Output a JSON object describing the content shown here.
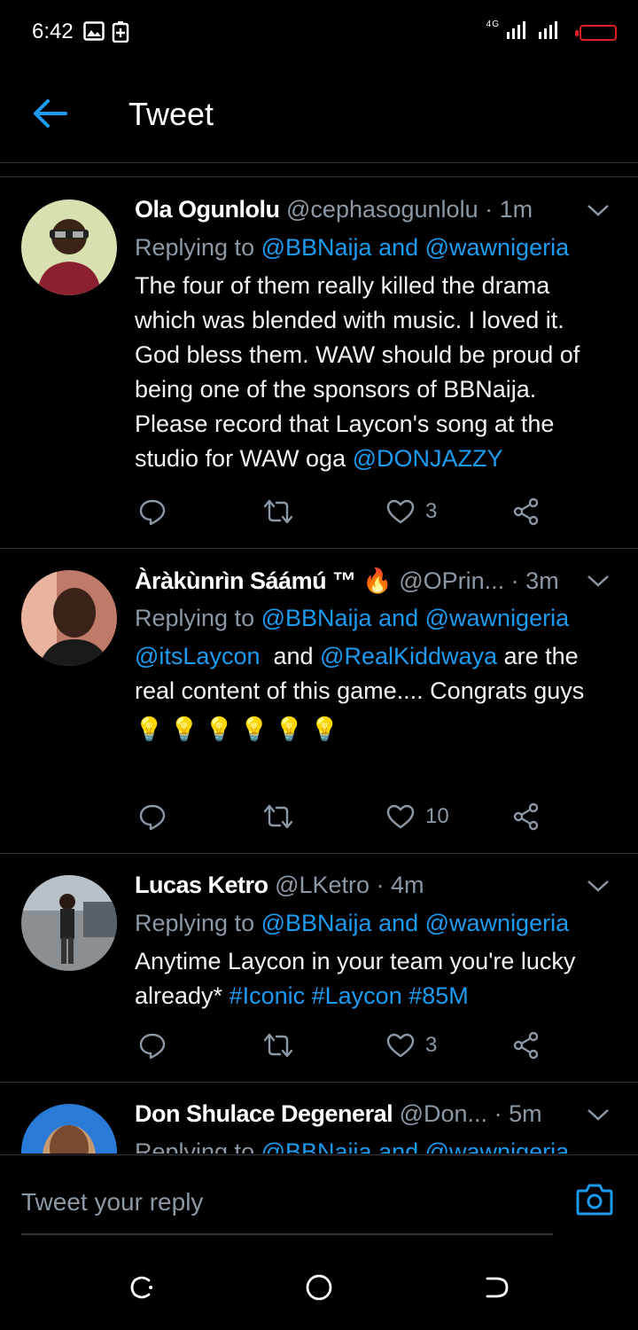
{
  "status_bar": {
    "time": "6:42",
    "signal_label": "4G"
  },
  "header": {
    "title": "Tweet"
  },
  "tweets": [
    {
      "name": "Ola Ogunlolu",
      "handle": "@cephasogunlolu",
      "ago": "1m",
      "replying_prefix": "Replying to ",
      "replying_to_1": "@BBNaija",
      "replying_and": " and ",
      "replying_to_2": "@wawnigeria",
      "text": "The four of them really killed the drama which was blended with music. I loved it. God bless them. WAW should be proud of being one of the sponsors of BBNaija. Please record that Laycon's song at the studio for WAW oga ",
      "mention_end": "@DONJAZZY",
      "likes": "3"
    },
    {
      "name": "Àràkùnrìn Sáámú ™",
      "emoji": "🔥",
      "handle": "@OPrin...",
      "ago": "3m",
      "replying_prefix": "Replying to ",
      "replying_to_1": "@BBNaija",
      "replying_and": " and ",
      "replying_to_2": "@wawnigeria",
      "mention_a": "@itsLaycon",
      "text_mid": "  and ",
      "mention_b": "@RealKiddwaya",
      "text": " are the real content of this game.... Congrats guys",
      "bulbs": "💡 💡 💡 💡 💡 💡",
      "likes": "10"
    },
    {
      "name": "Lucas Ketro",
      "handle": "@LKetro",
      "ago": "4m",
      "replying_prefix": "Replying to ",
      "replying_to_1": "@BBNaija",
      "replying_and": " and ",
      "replying_to_2": "@wawnigeria",
      "text": "Anytime Laycon in your team you're lucky already* ",
      "hashtags": "#Iconic #Laycon #85M",
      "likes": "3"
    },
    {
      "name": "Don Shulace Degeneral",
      "handle": "@Don...",
      "ago": "5m",
      "replying_prefix": "Replying to ",
      "replying_to_1": "@BBNaija",
      "replying_and": " and ",
      "replying_to_2": "@wawnigeria"
    }
  ],
  "reply_bar": {
    "placeholder": "Tweet your reply"
  },
  "colors": {
    "accent": "#1d9bf0",
    "background": "#000000",
    "muted": "#8b98a5",
    "battery": "#e02020"
  }
}
